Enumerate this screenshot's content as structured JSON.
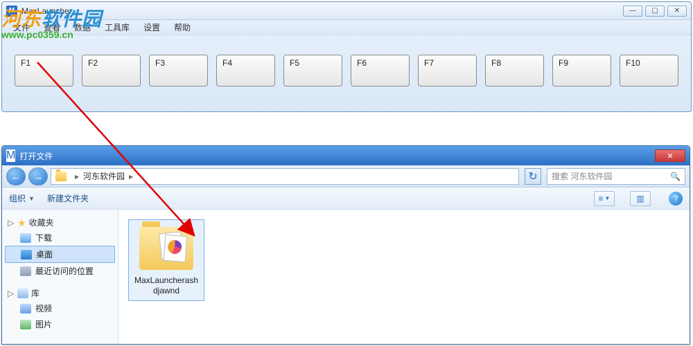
{
  "watermark": {
    "line1a": "河东",
    "line1b": "软件园",
    "url": "www.pc0359.cn"
  },
  "launcher": {
    "title": "MaxLauncher",
    "window_controls": {
      "min": "—",
      "max": "▢",
      "close": "✕"
    },
    "menu": [
      "文件",
      "查看",
      "数据",
      "工具库",
      "设置",
      "帮助"
    ],
    "fkeys": [
      "F1",
      "F2",
      "F3",
      "F4",
      "F5",
      "F6",
      "F7",
      "F8",
      "F9",
      "F10"
    ]
  },
  "dialog": {
    "title": "打开文件",
    "close": "✕",
    "nav": {
      "back": "←",
      "forward": "→",
      "refresh": "↻",
      "sep": "▸"
    },
    "breadcrumb": [
      "河东软件园"
    ],
    "search_placeholder": "搜索 河东软件园",
    "toolbar": {
      "organize": "组织",
      "newfolder": "新建文件夹",
      "view_icon": "≡",
      "preview_icon": "▥",
      "help": "?"
    },
    "sidebar": {
      "favorites": {
        "label": "收藏夹",
        "items": [
          {
            "icon": "dl",
            "label": "下载"
          },
          {
            "icon": "desktop",
            "label": "桌面",
            "selected": true
          },
          {
            "icon": "recent",
            "label": "最近访问的位置"
          }
        ]
      },
      "libraries": {
        "label": "库",
        "items": [
          {
            "icon": "vid",
            "label": "视频"
          },
          {
            "icon": "pic",
            "label": "图片"
          }
        ]
      }
    },
    "content": {
      "items": [
        {
          "name": "MaxLauncherashdjawnd",
          "type": "folder",
          "selected": true
        }
      ]
    }
  }
}
